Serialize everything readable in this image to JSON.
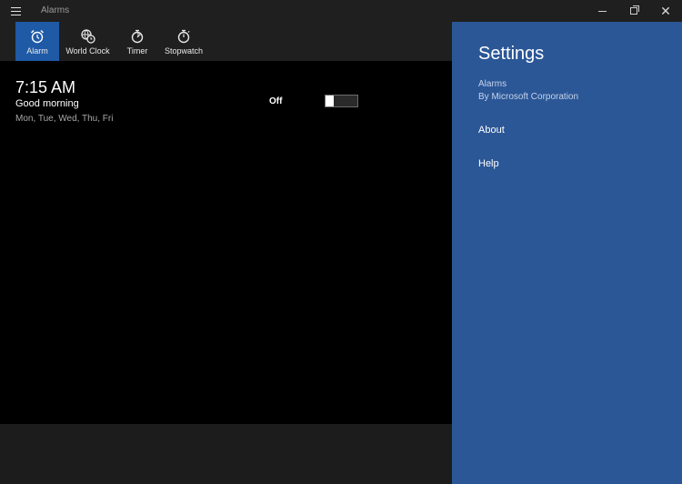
{
  "window": {
    "title": "Alarms"
  },
  "tabs": [
    {
      "label": "Alarm",
      "icon": "alarm-clock-icon",
      "selected": true
    },
    {
      "label": "World Clock",
      "icon": "world-clock-icon",
      "selected": false
    },
    {
      "label": "Timer",
      "icon": "timer-icon",
      "selected": false
    },
    {
      "label": "Stopwatch",
      "icon": "stopwatch-icon",
      "selected": false
    }
  ],
  "alarm": {
    "time": "7:15 AM",
    "name": "Good morning",
    "days": "Mon, Tue, Wed, Thu, Fri",
    "state_label": "Off",
    "enabled": false
  },
  "settings": {
    "title": "Settings",
    "app_name": "Alarms",
    "publisher": "By Microsoft Corporation",
    "links": [
      {
        "label": "About"
      },
      {
        "label": "Help"
      }
    ]
  },
  "colors": {
    "accent": "#1e5aa6",
    "settings_panel": "#2b5797",
    "chrome": "#1f1f1f",
    "background": "#000000"
  }
}
